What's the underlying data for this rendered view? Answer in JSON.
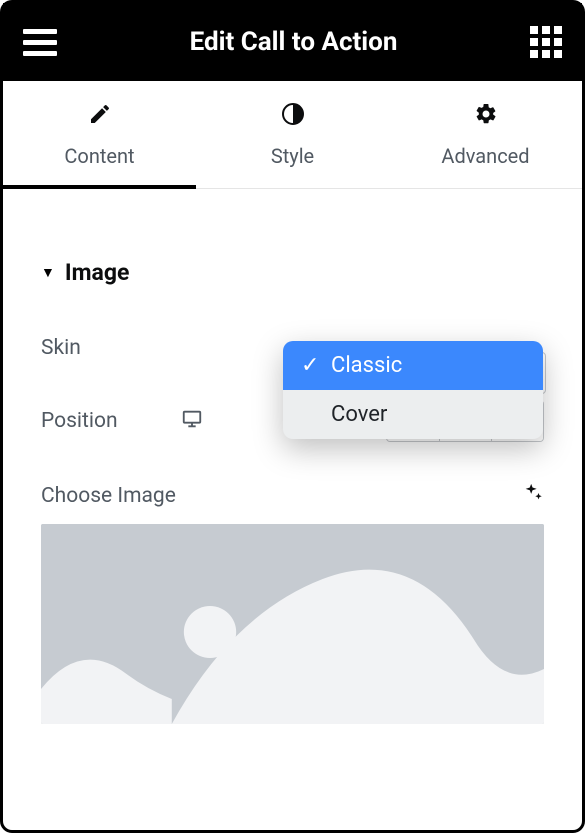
{
  "header": {
    "title": "Edit Call to Action"
  },
  "tabs": {
    "content": "Content",
    "style": "Style",
    "advanced": "Advanced"
  },
  "section": {
    "title": "Image"
  },
  "fields": {
    "skin": {
      "label": "Skin",
      "options": [
        "Classic",
        "Cover"
      ],
      "selected": "Classic"
    },
    "position": {
      "label": "Position"
    },
    "choose": {
      "label": "Choose Image"
    }
  }
}
